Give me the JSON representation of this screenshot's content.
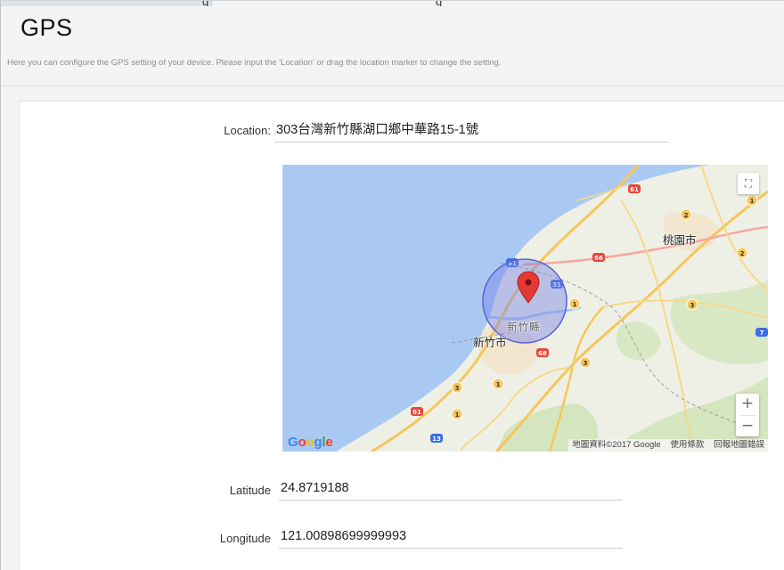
{
  "header": {
    "cut_tab_text": "g",
    "cut_title_text": "g",
    "title": "GPS",
    "subtitle": "Here you can configure the GPS setting of your device. Please input the 'Location' or drag the location marker to change the setting."
  },
  "form": {
    "location_label": "Location:",
    "location_value": "303台灣新竹縣湖口鄉中華路15-1號",
    "latitude_label": "Latitude",
    "latitude_value": "24.8719188",
    "longitude_label": "Longitude",
    "longitude_value": "121.00898699999993"
  },
  "map": {
    "labels": {
      "taoyuan": "桃園市",
      "hsinchu_county": "新竹縣",
      "hsinchu_city": "新竹市"
    },
    "route_badges": [
      "61",
      "2",
      "1",
      "66",
      "61",
      "31",
      "1",
      "3",
      "68",
      "3",
      "3",
      "1",
      "61",
      "1",
      "13",
      "2",
      "7"
    ],
    "google_logo": [
      "G",
      "o",
      "o",
      "g",
      "l",
      "e"
    ],
    "footer": {
      "map_data": "地圖資料©2017 Google",
      "terms": "使用條款",
      "report": "回報地圖錯誤"
    },
    "fullscreen_icon": "fullscreen-icon",
    "zoom_in": "+",
    "zoom_out": "−",
    "colors": {
      "sea": "#a9c9f2",
      "land": "#eef0e6",
      "green": "#cfe2b8",
      "urban": "#f3e9d8",
      "highway": "#f7c65a",
      "radius_fill": "#7b82e6",
      "marker": "#e53935"
    }
  }
}
